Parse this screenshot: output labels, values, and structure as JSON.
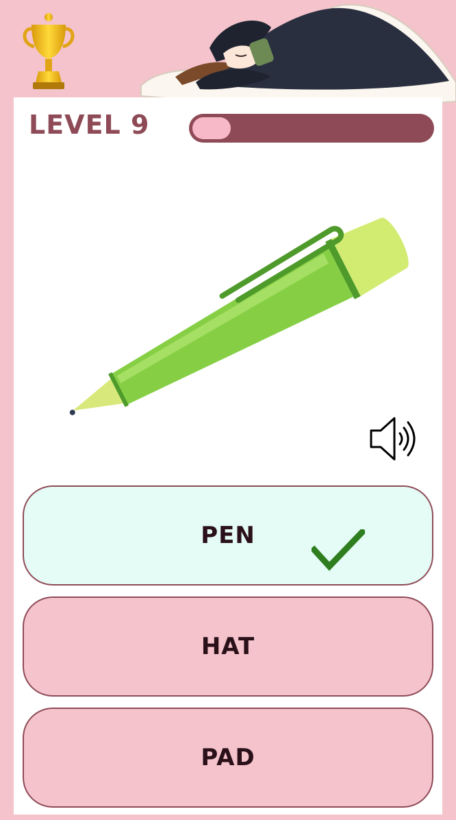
{
  "header": {
    "trophy_icon": "trophy-icon",
    "character_illustration": "sleeping-girl-illustration"
  },
  "level": {
    "label": "LEVEL 9",
    "progress": 0.16
  },
  "question": {
    "image_icon": "green-pen-illustration",
    "sound_icon": "speaker-icon"
  },
  "options": [
    {
      "label": "PEN",
      "state": "correct",
      "icon": "checkmark-icon"
    },
    {
      "label": "HAT",
      "state": "normal"
    },
    {
      "label": "PAD",
      "state": "normal"
    }
  ],
  "colors": {
    "background": "#f4c3cc",
    "accent": "#8e4a56",
    "progress_fill": "#f7b8c8",
    "correct_bg": "#e4fbf6",
    "check": "#2e7d1e"
  }
}
